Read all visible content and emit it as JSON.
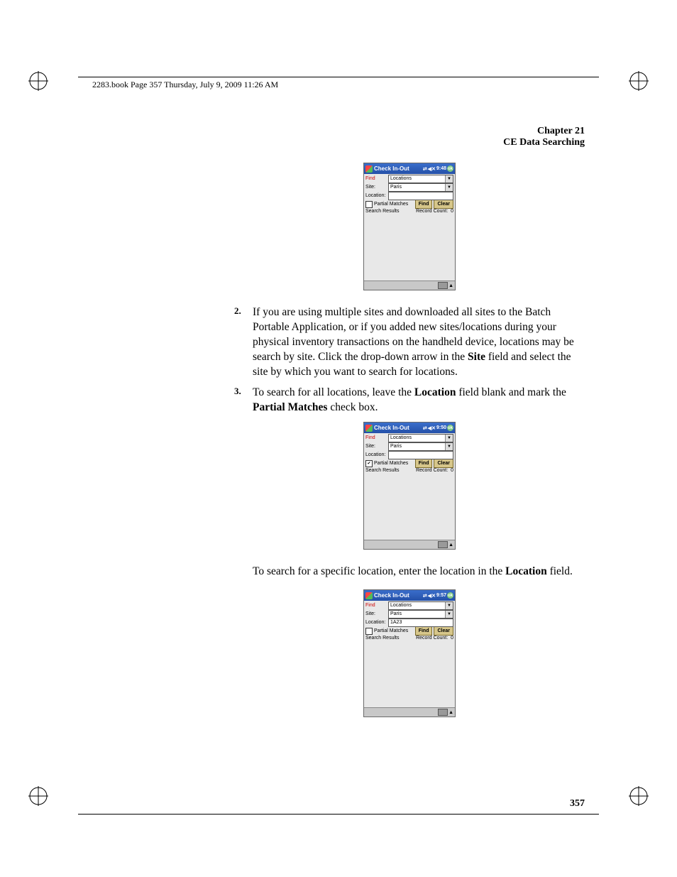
{
  "header_line": "2283.book  Page 357  Thursday, July 9, 2009  11:26 AM",
  "chapter": {
    "line1": "Chapter 21",
    "line2": "CE Data Searching"
  },
  "shot1": {
    "title": "Check In-Out",
    "clock": "9:48",
    "find_label": "Find",
    "find_value": "Locations",
    "site_label": "Site:",
    "site_value": "Paris",
    "loc_label": "Location:",
    "loc_value": "",
    "partial_checked": false,
    "partial_label": "Partial Matches",
    "find_btn": "Find",
    "clear_btn": "Clear",
    "sr_label": "Search Results",
    "rc_label": "Record Count:",
    "rc_value": "0"
  },
  "step2": {
    "num": "2.",
    "text_a": "If you are using multiple sites and downloaded all sites to the Batch Portable Application, or if you added new sites/locations during your physical inventory transactions on the handheld device, locations may be search by site. Click the drop-down arrow in the ",
    "bold1": "Site",
    "text_b": " field and select the site by which you want to search for locations."
  },
  "step3": {
    "num": "3.",
    "text_a": "To search for all locations, leave the ",
    "bold1": "Location",
    "text_b": " field blank and mark the ",
    "bold2": "Partial Matches",
    "text_c": " check box."
  },
  "shot2": {
    "title": "Check In-Out",
    "clock": "9:50",
    "find_label": "Find",
    "find_value": "Locations",
    "site_label": "Site:",
    "site_value": "Paris",
    "loc_label": "Location:",
    "loc_value": "",
    "partial_checked": true,
    "partial_label": "Partial Matches",
    "find_btn": "Find",
    "clear_btn": "Clear",
    "sr_label": "Search Results",
    "rc_label": "Record Count:",
    "rc_value": "0"
  },
  "para_mid": {
    "text_a": "To search for a specific location, enter the location in the ",
    "bold1": "Location",
    "text_b": " field."
  },
  "shot3": {
    "title": "Check In-Out",
    "clock": "9:57",
    "find_label": "Find",
    "find_value": "Locations",
    "site_label": "Site:",
    "site_value": "Paris",
    "loc_label": "Location:",
    "loc_value": "1A23",
    "partial_checked": false,
    "partial_label": "Partial Matches",
    "find_btn": "Find",
    "clear_btn": "Clear",
    "sr_label": "Search Results",
    "rc_label": "Record Count:",
    "rc_value": "0"
  },
  "page_number": "357"
}
